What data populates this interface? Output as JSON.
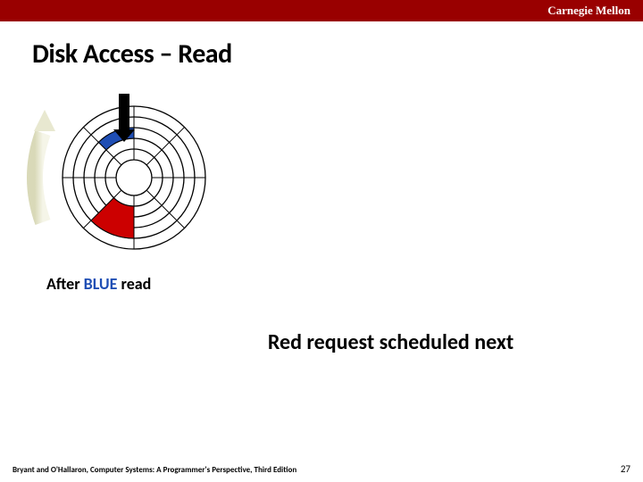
{
  "header": {
    "institution": "Carnegie Mellon"
  },
  "title": "Disk Access – Read",
  "caption": {
    "prefix": "After ",
    "highlight": "BLUE",
    "suffix": " read"
  },
  "subtitle": "Red request scheduled next",
  "footer": {
    "attribution": "Bryant and O'Hallaron, Computer Systems: A Programmer's Perspective, Third Edition",
    "page": "27"
  },
  "disk": {
    "tracks": 6,
    "colors": {
      "blue_sector": "#1f4eb4",
      "red_sector": "#cc0000",
      "pointer": "#000"
    }
  }
}
